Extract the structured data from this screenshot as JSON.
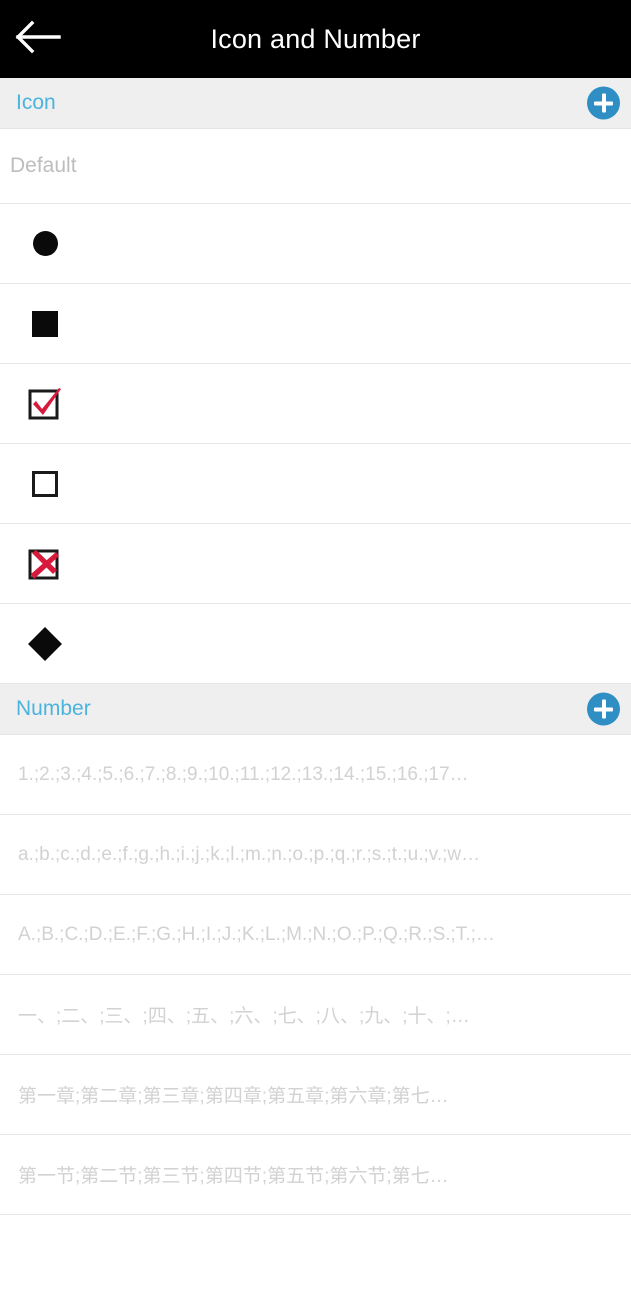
{
  "appbar": {
    "back_icon": "arrow-left-icon",
    "title": "Icon and Number"
  },
  "colors": {
    "appbar_bg": "#000000",
    "appbar_text": "#ffffff",
    "section_bg": "#efeff0",
    "section_text": "#4cb3dc",
    "add_button": "#2f8fc4",
    "row_text": "#bdbdbd",
    "number_text": "#d2d2d2",
    "glyph_black": "#0a0a0a",
    "glyph_red": "#d8193c",
    "divider": "#e6e6e6"
  },
  "sections": [
    {
      "key": "icon",
      "label": "Icon",
      "add_label": "+",
      "add_icon": "plus-circle-icon",
      "rows": [
        {
          "type": "text",
          "label": "Default",
          "icon": "none"
        },
        {
          "type": "glyph",
          "label": "",
          "icon": "filled-circle-bullet-icon"
        },
        {
          "type": "glyph",
          "label": "",
          "icon": "filled-square-bullet-icon"
        },
        {
          "type": "glyph",
          "label": "",
          "icon": "checked-checkbox-icon"
        },
        {
          "type": "glyph",
          "label": "",
          "icon": "empty-checkbox-icon"
        },
        {
          "type": "glyph",
          "label": "",
          "icon": "crossed-checkbox-icon"
        },
        {
          "type": "glyph",
          "label": "",
          "icon": "filled-diamond-bullet-icon"
        }
      ]
    },
    {
      "key": "number",
      "label": "Number",
      "add_label": "+",
      "add_icon": "plus-circle-icon",
      "rows": [
        {
          "type": "text",
          "label": "1.;2.;3.;4.;5.;6.;7.;8.;9.;10.;11.;12.;13.;14.;15.;16.;17…",
          "icon": "none"
        },
        {
          "type": "text",
          "label": "a.;b.;c.;d.;e.;f.;g.;h.;i.;j.;k.;l.;m.;n.;o.;p.;q.;r.;s.;t.;u.;v.;w…",
          "icon": "none"
        },
        {
          "type": "text",
          "label": "A.;B.;C.;D.;E.;F.;G.;H.;I.;J.;K.;L.;M.;N.;O.;P.;Q.;R.;S.;T.;…",
          "icon": "none"
        },
        {
          "type": "text",
          "label": "一、;二、;三、;四、;五、;六、;七、;八、;九、;十、;…",
          "icon": "none"
        },
        {
          "type": "text",
          "label": "第一章;第二章;第三章;第四章;第五章;第六章;第七…",
          "icon": "none"
        },
        {
          "type": "text",
          "label": "第一节;第二节;第三节;第四节;第五节;第六节;第七…",
          "icon": "none"
        }
      ]
    }
  ]
}
